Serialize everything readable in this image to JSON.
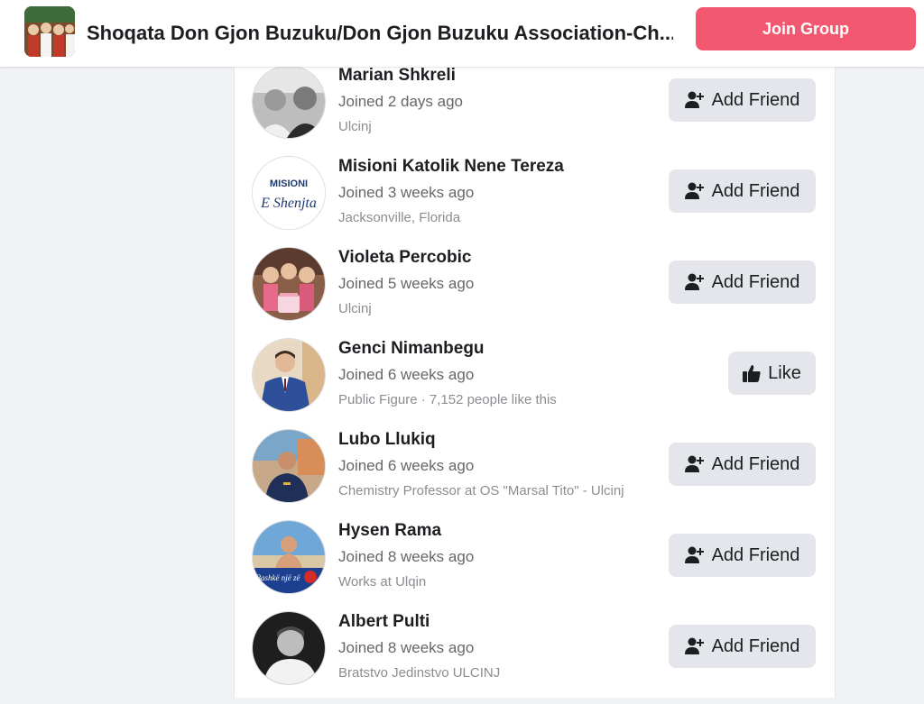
{
  "header": {
    "group_title": "Shoqata Don Gjon Buzuku/Don Gjon Buzuku Association-Ch...",
    "join_label": "Join Group",
    "join_color": "#f2586f"
  },
  "members": [
    {
      "name": "Marian Shkreli",
      "joined": "Joined 2 days ago",
      "sub": "Ulcinj",
      "action": "Add Friend"
    },
    {
      "name": "Misioni Katolik Nene Tereza",
      "joined": "Joined 3 weeks ago",
      "sub": "Jacksonville, Florida",
      "action": "Add Friend",
      "avatar_text_1": "MISIONI",
      "avatar_text_2": "E Shenjta"
    },
    {
      "name": "Violeta Percobic",
      "joined": "Joined 5 weeks ago",
      "sub": "Ulcinj",
      "action": "Add Friend"
    },
    {
      "name": "Genci Nimanbegu",
      "joined": "Joined 6 weeks ago",
      "sub": "Public Figure · 7,152 people like this",
      "action": "Like"
    },
    {
      "name": "Lubo Llukiq",
      "joined": "Joined 6 weeks ago",
      "sub": "Chemistry Professor at OS \"Marsal Tito\" - Ulcinj",
      "action": "Add Friend"
    },
    {
      "name": "Hysen Rama",
      "joined": "Joined 8 weeks ago",
      "sub": "Works at Ulqin",
      "action": "Add Friend",
      "avatar_text": "Bashkë një zë"
    },
    {
      "name": "Albert Pulti",
      "joined": "Joined 8 weeks ago",
      "sub": "Bratstvo Jedinstvo ULCINJ",
      "action": "Add Friend"
    }
  ]
}
